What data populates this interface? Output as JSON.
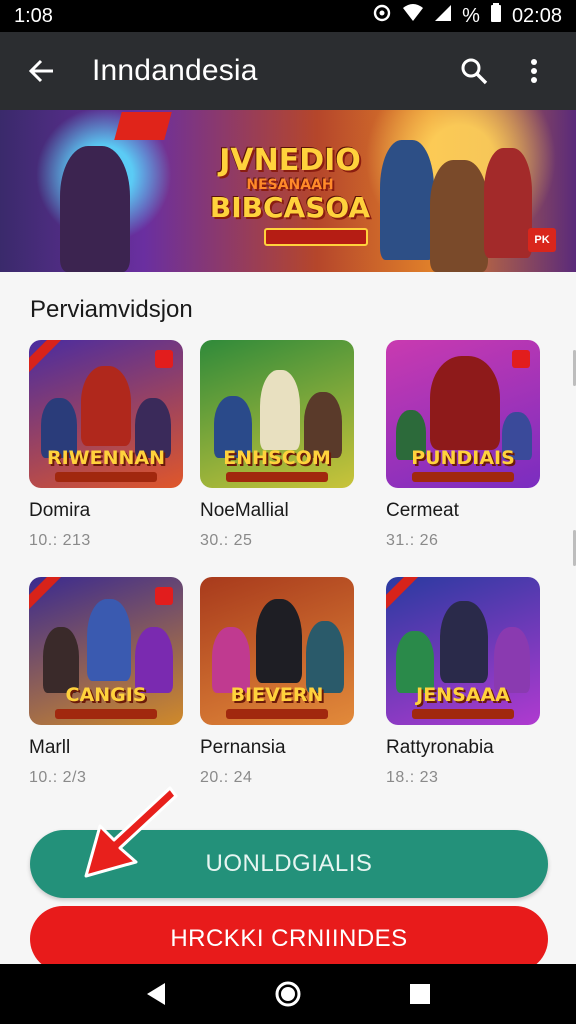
{
  "status_bar": {
    "time": "1:08",
    "battery_label": "%",
    "clock_right": "02:08"
  },
  "app_bar": {
    "title": "Inndandesia"
  },
  "banner": {
    "title_line1": "JVNEDIO",
    "title_line2": "NESANAAH",
    "title_line3": "BIBCASOA",
    "badge": "PK"
  },
  "section": {
    "title": "Perviamvidsjon"
  },
  "games": [
    {
      "name": "Domira",
      "meta": "10.: 213",
      "logo": "RIWENNAN",
      "palette": [
        "#4a2ca0",
        "#e0572a"
      ]
    },
    {
      "name": "NoeMallial",
      "meta": "30.: 25",
      "logo": "ENHSCOM",
      "palette": [
        "#2f8a3a",
        "#c9c43a"
      ]
    },
    {
      "name": "Cermeat",
      "meta": "31.: 26",
      "logo": "PUNDIAIS",
      "palette": [
        "#c93ab0",
        "#7a2dc0"
      ]
    },
    {
      "name": "Marll",
      "meta": "10.: 2/3",
      "logo": "CANGIS",
      "palette": [
        "#3a2a90",
        "#d08a2a"
      ]
    },
    {
      "name": "Pernansia",
      "meta": "20.: 24",
      "logo": "BIEVERN",
      "palette": [
        "#a83a1c",
        "#e28a3a"
      ]
    },
    {
      "name": "Rattyronabia",
      "meta": "18.: 23",
      "logo": "JENSAAA",
      "palette": [
        "#2a3aa0",
        "#b03ad0"
      ]
    }
  ],
  "buttons": {
    "primary": "UONLDGIALIS",
    "secondary": "HRCKKI CRNIINDES"
  },
  "colors": {
    "appbar": "#2b2d30",
    "primary_button": "#23917a",
    "secondary_button": "#e81b1b"
  },
  "icons": {
    "back": "arrow-left-icon",
    "search": "search-icon",
    "more": "more-vert-icon",
    "pointer": "red-arrow-icon"
  }
}
